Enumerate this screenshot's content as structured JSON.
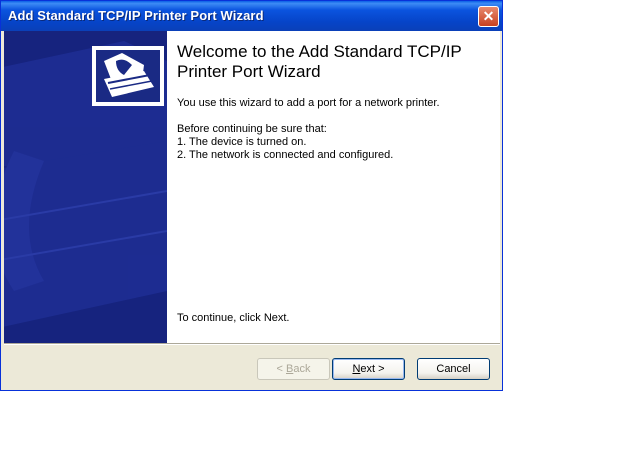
{
  "window": {
    "title": "Add Standard TCP/IP Printer Port Wizard",
    "close_glyph": "✕"
  },
  "content": {
    "heading": "Welcome to the Add Standard TCP/IP Printer Port Wizard",
    "intro": "You use this wizard to add a port for a network printer.",
    "before_label": "Before continuing be sure that:",
    "requirements": [
      "1.  The device is turned on.",
      "2.  The network is connected and configured."
    ],
    "continue_text": "To continue, click Next."
  },
  "buttons": {
    "back": {
      "prefix": "< ",
      "mnemonic": "B",
      "rest": "ack",
      "enabled": false
    },
    "next": {
      "mnemonic": "N",
      "rest": "ext >",
      "enabled": true
    },
    "cancel": {
      "label": "Cancel",
      "enabled": true
    }
  },
  "colors": {
    "banner": "#16237e",
    "titlebar": "#0b54df",
    "dialog_face": "#ece9d8"
  },
  "icons": [
    "printer-wizard-icon",
    "close-icon"
  ]
}
